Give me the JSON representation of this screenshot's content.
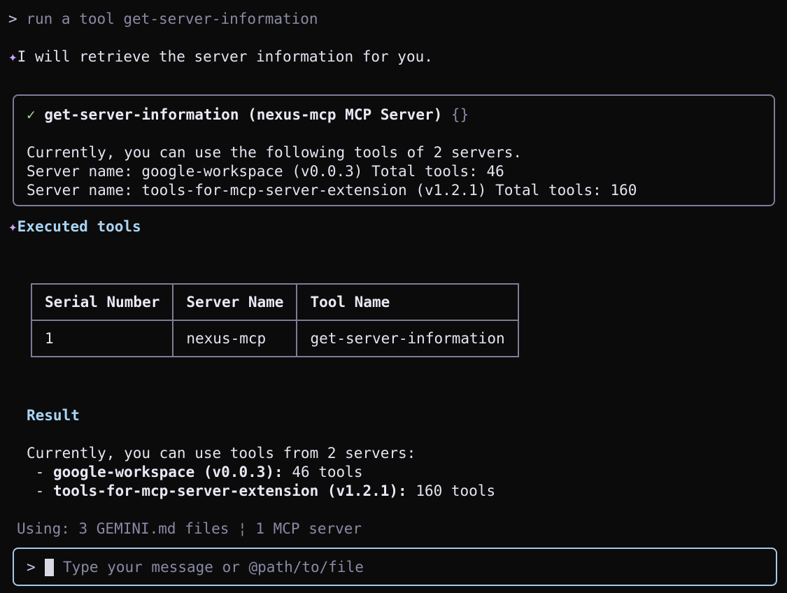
{
  "prompt": {
    "symbol": ">",
    "text": "run a tool get-server-information"
  },
  "assistant_message": {
    "icon": "sparkle-icon",
    "text": "I will retrieve the server information for you."
  },
  "tool_call": {
    "status_icon": "check-icon",
    "title": "get-server-information (nexus-mcp MCP Server)",
    "args": "{}",
    "output": [
      "Currently, you can use the following tools of 2 servers.",
      "Server name: google-workspace (v0.0.3) Total tools: 46",
      "Server name: tools-for-mcp-server-extension (v1.2.1) Total tools: 160"
    ]
  },
  "executed": {
    "icon": "sparkle-icon",
    "heading": "Executed tools",
    "table": {
      "headers": [
        "Serial Number",
        "Server Name",
        "Tool Name"
      ],
      "rows": [
        [
          "1",
          "nexus-mcp",
          "get-server-information"
        ]
      ]
    }
  },
  "result": {
    "heading": "Result",
    "intro": "Currently, you can use tools from 2 servers:",
    "items": [
      {
        "bullet": " - ",
        "name": "google-workspace (v0.0.3):",
        "detail": " 46 tools"
      },
      {
        "bullet": " - ",
        "name": "tools-for-mcp-server-extension (v1.2.1):",
        "detail": " 160 tools"
      }
    ]
  },
  "footer": {
    "status": "Using: 3 GEMINI.md files ¦ 1 MCP server"
  },
  "input": {
    "symbol": ">",
    "placeholder": "Type your message or @path/to/file"
  },
  "colors": {
    "background": "#0b0b0b",
    "border": "#7c7c9a",
    "input_border": "#a6c8e6",
    "accent_purple": "#c7a6ff",
    "accent_blue": "#a9d4f5",
    "success_green": "#9fd39a"
  }
}
